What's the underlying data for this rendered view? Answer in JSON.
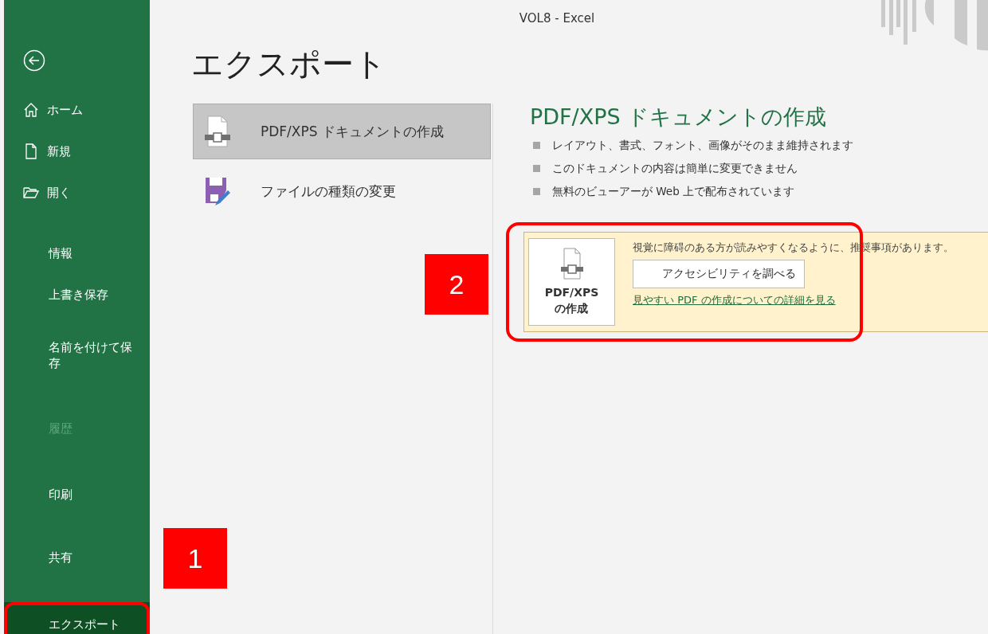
{
  "window": {
    "title": "VOL8  -  Excel"
  },
  "sidebar": {
    "items": [
      {
        "kind": "back"
      },
      {
        "kind": "home",
        "label": "ホーム",
        "selected": false,
        "disabled": false
      },
      {
        "kind": "new",
        "label": "新規",
        "selected": false,
        "disabled": false
      },
      {
        "kind": "open",
        "label": "開く",
        "selected": false,
        "disabled": false
      },
      {
        "kind": "divider"
      },
      {
        "kind": "text",
        "label": "情報",
        "selected": false,
        "disabled": false
      },
      {
        "kind": "text",
        "label": "上書き保存",
        "selected": false,
        "disabled": false
      },
      {
        "kind": "text",
        "label": "名前を付けて保存",
        "selected": false,
        "disabled": false
      },
      {
        "kind": "text",
        "label": "履歴",
        "selected": false,
        "disabled": true
      },
      {
        "kind": "text",
        "label": "印刷",
        "selected": false,
        "disabled": false
      },
      {
        "kind": "text",
        "label": "共有",
        "selected": false,
        "disabled": false
      },
      {
        "kind": "text",
        "label": "エクスポート",
        "selected": true,
        "disabled": false
      }
    ]
  },
  "page_title": "エクスポート",
  "options": [
    {
      "kind": "pdf",
      "label": "PDF/XPS ドキュメントの作成",
      "selected": true
    },
    {
      "kind": "filetype",
      "label": "ファイルの種類の変更",
      "selected": false
    }
  ],
  "detail": {
    "heading": "PDF/XPS ドキュメントの作成",
    "bullets": [
      "レイアウト、書式、フォント、画像がそのまま維持されます",
      "このドキュメントの内容は簡単に変更できません",
      "無料のビューアーが Web 上で配布されています"
    ],
    "notice": {
      "create_button": [
        "PDF/XPS",
        "の作成"
      ],
      "message": "視覚に障碍のある方が読みやすくなるように、推奨事項があります。",
      "check_button": "アクセシビリティを調べる",
      "link": "見やすい PDF の作成についての詳細を見る"
    }
  },
  "annotations": [
    {
      "label": "1"
    },
    {
      "label": "2"
    }
  ]
}
